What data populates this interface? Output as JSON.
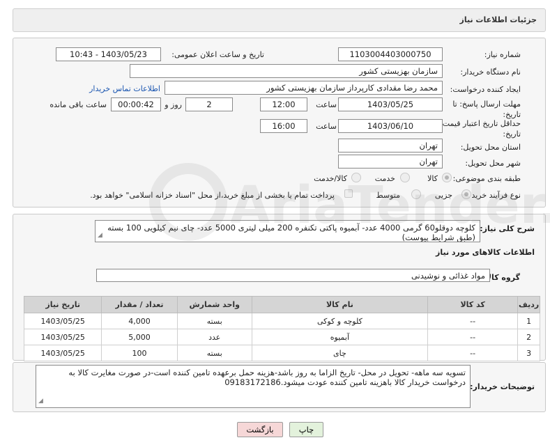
{
  "header": {
    "title": "جزئیات اطلاعات نیاز"
  },
  "form": {
    "need_number_label": "شماره نیاز:",
    "need_number": "1103004403000750",
    "announce_label": "تاریخ و ساعت اعلان عمومی:",
    "announce_value": "1403/05/23 - 10:43",
    "buyer_org_label": "نام دستگاه خریدار:",
    "buyer_org": "سازمان بهزیستی کشور",
    "creator_label": "ایجاد کننده درخواست:",
    "creator": "محمد رضا  مقدادی کارپرداز سازمان بهزیستی کشور",
    "contact_link": "اطلاعات تماس خریدار",
    "reply_deadline_label": "مهلت ارسال پاسخ: تا تاریخ:",
    "reply_date": "1403/05/25",
    "time_label": "ساعت",
    "reply_time": "12:00",
    "days_value": "2",
    "days_label": "روز و",
    "remaining_time": "00:00:42",
    "remaining_label": "ساعت باقی مانده",
    "price_validity_label": "حداقل تاریخ اعتبار قیمت: تا تاریخ:",
    "price_date": "1403/06/10",
    "price_time": "16:00",
    "province_label": "استان محل تحویل:",
    "province": "تهران",
    "city_label": "شهر محل تحویل:",
    "city": "تهران",
    "category_label": "طبقه بندی موضوعی:",
    "category_options": [
      "کالا",
      "خدمت",
      "کالا/خدمت"
    ],
    "purchase_type_label": "نوع فرآیند خرید :",
    "purchase_options": [
      "جزیی",
      "متوسط"
    ],
    "payment_note": "پرداخت تمام یا بخشی از مبلغ خرید،از محل \"اسناد خزانه اسلامی\" خواهد بود."
  },
  "description": {
    "label": "شرح کلی نیاز:",
    "text": "کلوچه دوقلو60 گرمی 4000 عدد- آبمیوه پاکتی تکنفره 200 میلی لیتری 5000 عدد- چای نیم کیلویی 100 بسته (طبق شرایط پیوست)"
  },
  "goods": {
    "section_title": "اطلاعات کالاهای مورد نیاز",
    "group_label": "گروه کالا:",
    "group_value": "مواد غذائی و نوشیدنی",
    "columns": [
      "ردیف",
      "کد کالا",
      "نام کالا",
      "واحد شمارش",
      "تعداد / مقدار",
      "تاریخ نیاز"
    ],
    "rows": [
      [
        "1",
        "--",
        "کلوچه و کوکی",
        "بسته",
        "4,000",
        "1403/05/25"
      ],
      [
        "2",
        "--",
        "آبمیوه",
        "عدد",
        "5,000",
        "1403/05/25"
      ],
      [
        "3",
        "--",
        "چای",
        "بسته",
        "100",
        "1403/05/25"
      ]
    ]
  },
  "buyer_notes": {
    "label": "توضیحات خریدار:",
    "text": "تسویه سه ماهه- تحویل در محل- تاریخ الزاما به روز باشد-هزینه حمل برعهده تامین کننده است-در صورت مغایرت کالا به درخواست خریدار کالا باهزینه تامین کننده عودت میشود.09183172186"
  },
  "buttons": {
    "print": "چاپ",
    "back": "بازگشت"
  },
  "watermark": {
    "text": "AriaTender.neT"
  },
  "colors": {
    "link": "#1a55b0",
    "back_button": "#f6d7d7",
    "print_button": "#e3f2dc",
    "table_header": "#d5d5d5"
  }
}
